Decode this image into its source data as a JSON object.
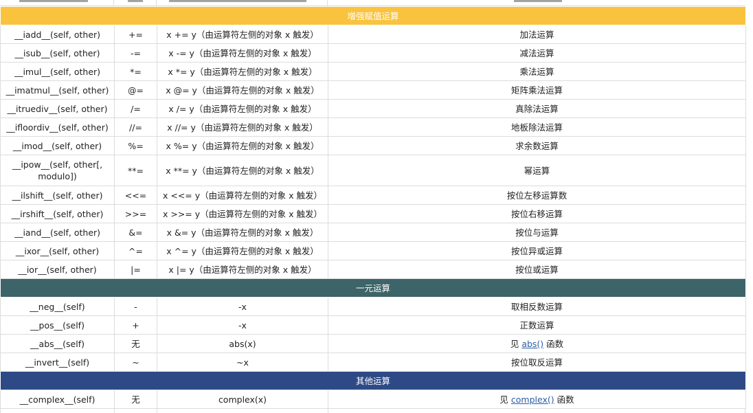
{
  "sections": {
    "augmented": {
      "title": "增强赋值运算"
    },
    "unary": {
      "title": "一元运算"
    },
    "other": {
      "title": "其他运算"
    }
  },
  "augmented_rows": [
    {
      "method": "__iadd__(self, other)",
      "op": "+=",
      "expr": "x += y（由运算符左侧的对象 x 触发）",
      "desc": "加法运算"
    },
    {
      "method": "__isub__(self, other)",
      "op": "-=",
      "expr": "x -= y（由运算符左侧的对象 x 触发）",
      "desc": "减法运算"
    },
    {
      "method": "__imul__(self, other)",
      "op": "*=",
      "expr": "x *= y（由运算符左侧的对象 x 触发）",
      "desc": "乘法运算"
    },
    {
      "method": "__imatmul__(self, other)",
      "op": "@=",
      "expr": "x @= y（由运算符左侧的对象 x 触发）",
      "desc": "矩阵乘法运算"
    },
    {
      "method": "__itruediv__(self, other)",
      "op": "/=",
      "expr": "x /= y（由运算符左侧的对象 x 触发）",
      "desc": "真除法运算"
    },
    {
      "method": "__ifloordiv__(self, other)",
      "op": "//=",
      "expr": "x //= y（由运算符左侧的对象 x 触发）",
      "desc": "地板除法运算"
    },
    {
      "method": "__imod__(self, other)",
      "op": "%=",
      "expr": "x %= y（由运算符左侧的对象 x 触发）",
      "desc": "求余数运算"
    },
    {
      "method": "__ipow__(self, other[, modulo])",
      "op": "**=",
      "expr": "x **= y（由运算符左侧的对象 x 触发）",
      "desc": "幂运算"
    },
    {
      "method": "__ilshift__(self, other)",
      "op": "<<=",
      "expr": "x <<= y（由运算符左侧的对象 x 触发）",
      "desc": "按位左移运算数"
    },
    {
      "method": "__irshift__(self, other)",
      "op": ">>=",
      "expr": "x >>= y（由运算符左侧的对象 x 触发）",
      "desc": "按位右移运算"
    },
    {
      "method": "__iand__(self, other)",
      "op": "&=",
      "expr": "x &= y（由运算符左侧的对象 x 触发）",
      "desc": "按位与运算"
    },
    {
      "method": "__ixor__(self, other)",
      "op": "^=",
      "expr": "x ^= y（由运算符左侧的对象 x 触发）",
      "desc": "按位异或运算"
    },
    {
      "method": "__ior__(self, other)",
      "op": "|=",
      "expr": "x |= y（由运算符左侧的对象 x 触发）",
      "desc": "按位或运算"
    }
  ],
  "unary_rows": [
    {
      "method": "__neg__(self)",
      "op": "-",
      "expr": "-x",
      "desc": "取相反数运算"
    },
    {
      "method": "__pos__(self)",
      "op": "+",
      "expr": "-x",
      "desc": "正数运算"
    },
    {
      "method": "__abs__(self)",
      "op": "无",
      "expr": "abs(x)",
      "desc_prefix": "见 ",
      "desc_link": "abs()",
      "desc_suffix": " 函数"
    },
    {
      "method": "__invert__(self)",
      "op": "~",
      "expr": "~x",
      "desc": "按位取反运算"
    }
  ],
  "other_rows": [
    {
      "method": "__complex__(self)",
      "op": "无",
      "expr": "complex(x)",
      "desc_prefix": "见 ",
      "desc_link": "complex()",
      "desc_suffix": " 函数"
    }
  ],
  "colors": {
    "augmented_header": "#f9c33e",
    "unary_header": "#3d6468",
    "other_header": "#2e4a86",
    "link": "#2b5da8"
  }
}
